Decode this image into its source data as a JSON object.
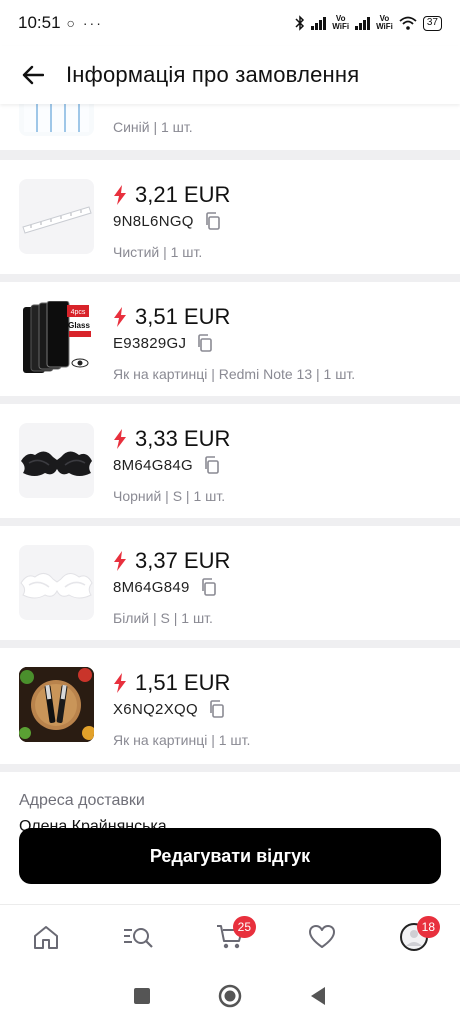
{
  "status_bar": {
    "time": "10:51",
    "left_icons": "○ ···",
    "vowifi": "Vo\nWiFi",
    "battery": "37"
  },
  "header": {
    "title": "Інформація про замовлення"
  },
  "items": [
    {
      "price": "",
      "code": "",
      "meta": "Синій | 1 шт.",
      "thumb": "blue-stripes-product"
    },
    {
      "price": "3,21 EUR",
      "code": "9N8L6NGQ",
      "meta": "Чистий | 1 шт.",
      "thumb": "clear-ruler-product"
    },
    {
      "price": "3,51 EUR",
      "code": "E93829GJ",
      "meta": "Як на картинці | Redmi Note 13 | 1 шт.",
      "thumb": "screen-protector-glass-product"
    },
    {
      "price": "3,33 EUR",
      "code": "8M64G84G",
      "meta": "Чорний | S | 1 шт.",
      "thumb": "black-bra-product"
    },
    {
      "price": "3,37 EUR",
      "code": "8M64G849",
      "meta": "Білий | S | 1 шт.",
      "thumb": "white-bra-product"
    },
    {
      "price": "1,51 EUR",
      "code": "X6NQ2XQQ",
      "meta": "Як на картинці | 1 шт.",
      "thumb": "knife-set-product"
    }
  ],
  "screen_protector_badge": "4pcs",
  "screen_protector_label": "Glass",
  "address": {
    "title": "Адреса доставки",
    "name": "Олена Крайнянська"
  },
  "actions": {
    "edit_review": "Редагувати відгук"
  },
  "nav": {
    "items": [
      "home-icon",
      "search-icon",
      "cart-icon",
      "heart-icon",
      "profile-icon"
    ],
    "cart_badge": "25",
    "profile_badge": "18"
  },
  "colors": {
    "accent_red": "#e8303d",
    "button_black": "#000000"
  }
}
